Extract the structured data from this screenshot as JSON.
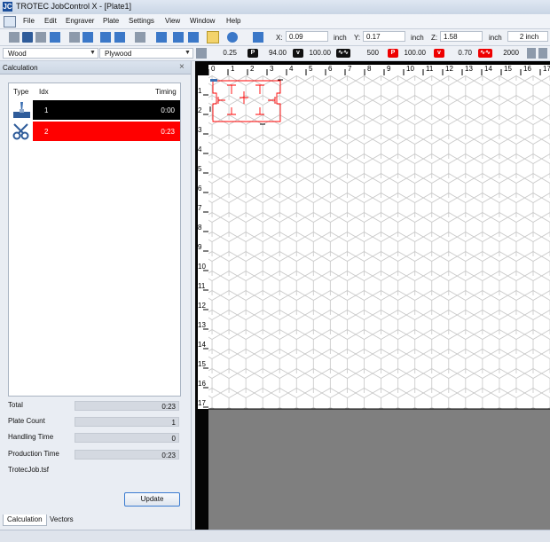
{
  "window": {
    "title": "TROTEC JobControl X - [Plate1]",
    "app_icon": "JC"
  },
  "menu": [
    "File",
    "Edit",
    "Engraver",
    "Plate",
    "Settings",
    "View",
    "Window",
    "Help"
  ],
  "coords": {
    "x_label": "X:",
    "x_value": "0.09",
    "x_unit": "inch",
    "y_label": "Y:",
    "y_value": "0.17",
    "y_unit": "inch",
    "z_label": "Z:",
    "z_value": "1.58",
    "z_unit": "inch",
    "zoom_value": "2 inch"
  },
  "material": {
    "group": "Wood",
    "name": "Plywood",
    "thickness": "0.25",
    "p_label": "P",
    "power": "94.00",
    "v_label": "v",
    "speed": "100.00",
    "ppi": "500",
    "cut_power": "100.00",
    "cut_speed": "0.70",
    "cut_freq": "2000"
  },
  "calculation": {
    "panel_title": "Calculation",
    "columns": {
      "type": "Type",
      "idx": "Idx",
      "timing": "Timing"
    },
    "rows": [
      {
        "idx": "1",
        "timing": "0:00",
        "color": "#000000",
        "icon": "engrave-icon"
      },
      {
        "idx": "2",
        "timing": "0:23",
        "color": "#ff0000",
        "icon": "scissors-icon"
      }
    ],
    "total_label": "Total",
    "total_value": "0:23",
    "plate_count_label": "Plate Count",
    "plate_count_value": "1",
    "handling_label": "Handling Time",
    "handling_value": "0",
    "production_label": "Production Time",
    "production_value": "0:23",
    "job_file": "TrotecJob.tsf",
    "update_label": "Update"
  },
  "tabs": [
    "Calculation",
    "Vectors"
  ],
  "ruler": {
    "h_ticks": [
      "0",
      "1",
      "2",
      "3",
      "4",
      "5",
      "6",
      "7",
      "8",
      "9",
      "10",
      "11",
      "12",
      "13",
      "14",
      "15",
      "16",
      "17"
    ],
    "v_ticks": [
      "1",
      "2",
      "3",
      "4",
      "5",
      "6",
      "7",
      "8",
      "9",
      "10",
      "11",
      "12",
      "13",
      "14",
      "15",
      "16",
      "17"
    ]
  },
  "colors": {
    "cut_red": "#ff0000",
    "hex_grid": "#c8c8c8",
    "plate_bg": "#ffffff",
    "outside_plate": "#7f7f7f"
  }
}
